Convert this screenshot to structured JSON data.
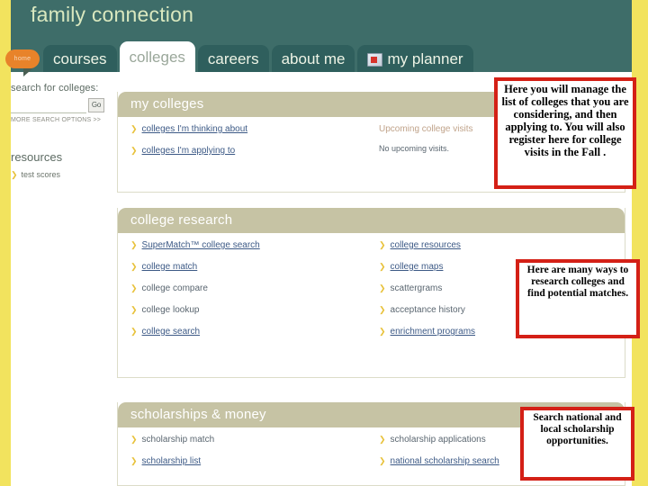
{
  "app": {
    "brand": "family connection",
    "home_label": "home"
  },
  "tabs": [
    {
      "label": "courses",
      "active": false,
      "icon": null
    },
    {
      "label": "colleges",
      "active": true,
      "icon": null
    },
    {
      "label": "careers",
      "active": false,
      "icon": null
    },
    {
      "label": "about me",
      "active": false,
      "icon": null
    },
    {
      "label": "my planner",
      "active": false,
      "icon": "planner-icon"
    }
  ],
  "sidebar": {
    "search_label": "search for colleges:",
    "search_value": "",
    "search_placeholder": "",
    "go_label": "Go",
    "more_options": "MORE SEARCH OPTIONS >>",
    "resources_title": "resources",
    "resources_links": [
      {
        "label": "test scores",
        "underlined": false
      }
    ]
  },
  "panels": [
    {
      "title": "my colleges",
      "left_links": [
        {
          "label": "colleges I'm thinking about",
          "underlined": true
        },
        {
          "label": "colleges I'm applying to",
          "underlined": true
        }
      ],
      "right_links": [],
      "visits_title": "Upcoming college visits",
      "visits_text": "No upcoming visits."
    },
    {
      "title": "college research",
      "left_links": [
        {
          "label": "SuperMatch™ college search",
          "underlined": true
        },
        {
          "label": "college match",
          "underlined": true
        },
        {
          "label": "college compare",
          "underlined": false
        },
        {
          "label": "college lookup",
          "underlined": false
        },
        {
          "label": "college search",
          "underlined": true
        }
      ],
      "right_links": [
        {
          "label": "college resources",
          "underlined": true
        },
        {
          "label": "college maps",
          "underlined": true
        },
        {
          "label": "scattergrams",
          "underlined": false
        },
        {
          "label": "acceptance history",
          "underlined": false
        },
        {
          "label": "enrichment programs",
          "underlined": true
        }
      ]
    },
    {
      "title": "scholarships & money",
      "left_links": [
        {
          "label": "scholarship match",
          "underlined": false
        },
        {
          "label": "scholarship list",
          "underlined": true
        }
      ],
      "right_links": [
        {
          "label": "scholarship applications",
          "underlined": false
        },
        {
          "label": "national scholarship search",
          "underlined": true
        }
      ]
    }
  ],
  "callouts": [
    {
      "text": "Here you will manage the list of colleges that you are considering, and then applying to.  You will also register here for college visits in the Fall ."
    },
    {
      "text": "Here are many ways to research colleges and find potential matches."
    },
    {
      "text": "Search national and local scholarship opportunities."
    }
  ],
  "colors": {
    "header_teal": "#3e6d69",
    "tab_teal": "#2f5f5d",
    "yellow_band": "#f2e35e",
    "panel_head_tan": "#c6c3a4",
    "callout_red": "#d42016",
    "home_orange": "#e8832a",
    "chevron_gold": "#e8c23c",
    "link_blue": "#3d5a86"
  }
}
